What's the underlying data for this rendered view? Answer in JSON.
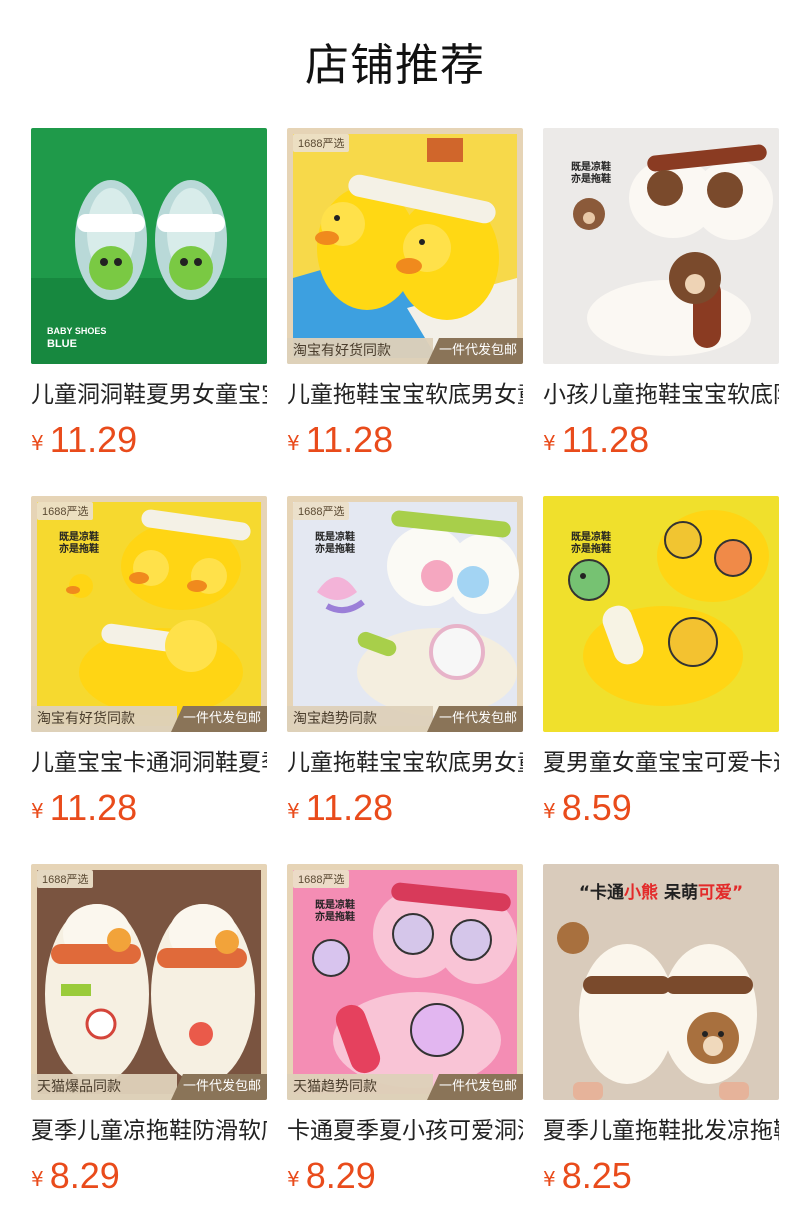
{
  "page": {
    "title": "店铺推荐"
  },
  "products": [
    {
      "title": "儿童洞洞鞋夏男女童宝宝软底",
      "currency": "¥",
      "price": "11.29",
      "image": {
        "theme": "green",
        "label_line1": "BABY SHOES",
        "label_line2": "BLUE"
      }
    },
    {
      "title": "儿童拖鞋宝宝软底男女童防滑",
      "currency": "¥",
      "price": "11.28",
      "image": {
        "theme": "yellow-duck",
        "badge_top": "1688严选",
        "band_left": "淘宝有好货同款",
        "band_right": "一件代发包邮"
      }
    },
    {
      "title": "小孩儿童拖鞋宝宝软底防滑",
      "currency": "¥",
      "price": "11.28",
      "image": {
        "theme": "bear-grey",
        "sticker_line1": "既是凉鞋",
        "sticker_line2": "亦是拖鞋"
      }
    },
    {
      "title": "儿童宝宝卡通洞洞鞋夏季",
      "currency": "¥",
      "price": "11.28",
      "image": {
        "theme": "yellow-duck-2",
        "badge_top": "1688严选",
        "sticker_line1": "既是凉鞋",
        "sticker_line2": "亦是拖鞋",
        "band_left": "淘宝有好货同款",
        "band_right": "一件代发包邮"
      }
    },
    {
      "title": "儿童拖鞋宝宝软底男女童",
      "currency": "¥",
      "price": "11.28",
      "image": {
        "theme": "unicorn",
        "badge_top": "1688严选",
        "sticker_line1": "既是凉鞋",
        "sticker_line2": "亦是拖鞋",
        "band_left": "淘宝趋势同款",
        "band_right": "一件代发包邮"
      }
    },
    {
      "title": "夏男童女童宝宝可爱卡通",
      "currency": "¥",
      "price": "8.59",
      "image": {
        "theme": "dino-yellow",
        "sticker_line1": "既是凉鞋",
        "sticker_line2": "亦是拖鞋"
      }
    },
    {
      "title": "夏季儿童凉拖鞋防滑软底",
      "currency": "¥",
      "price": "8.29",
      "image": {
        "theme": "astronaut",
        "badge_top": "1688严选",
        "band_left": "天猫爆品同款",
        "band_right": "一件代发包邮"
      }
    },
    {
      "title": "卡通夏季夏小孩可爱洞洞鞋",
      "currency": "¥",
      "price": "8.29",
      "image": {
        "theme": "pink",
        "badge_top": "1688严选",
        "sticker_line1": "既是凉鞋",
        "sticker_line2": "亦是拖鞋",
        "band_left": "天猫趋势同款",
        "band_right": "一件代发包邮"
      }
    },
    {
      "title": "夏季儿童拖鞋批发凉拖鞋",
      "currency": "¥",
      "price": "8.25",
      "image": {
        "theme": "bear-cream",
        "headline_a": "“卡通",
        "headline_b": "小熊",
        "headline_c": " 呆萌",
        "headline_d": "可爱”"
      }
    }
  ]
}
